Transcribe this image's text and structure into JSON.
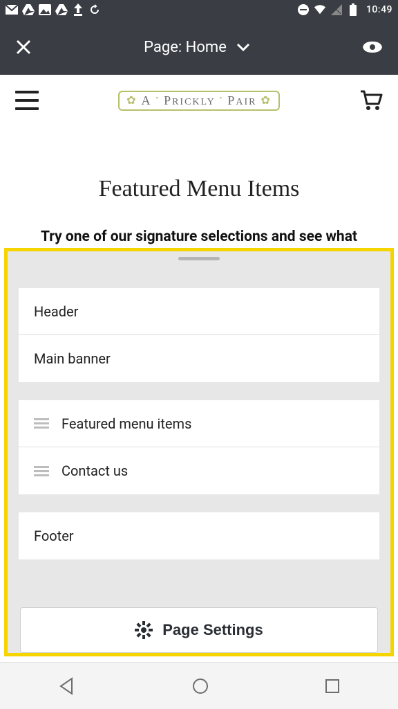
{
  "statusbar": {
    "time": "10:49",
    "left_icons": [
      "gmail-icon",
      "drive-icon",
      "photos-icon",
      "drive-icon-2",
      "upload-icon",
      "sync-icon"
    ],
    "right_icons": [
      "dnd-icon",
      "wifi-icon",
      "signal-icon",
      "battery-icon"
    ]
  },
  "appbar": {
    "title": "Page: Home"
  },
  "site": {
    "logo_text": "A · Prickly · Pair"
  },
  "page": {
    "heading": "Featured Menu Items",
    "tagline": "Try one of our signature selections and see what"
  },
  "sheet": {
    "group1": [
      {
        "label": "Header",
        "has_grip": false
      },
      {
        "label": "Main banner",
        "has_grip": false
      }
    ],
    "group2": [
      {
        "label": "Featured menu items",
        "has_grip": true
      },
      {
        "label": "Contact us",
        "has_grip": true
      }
    ],
    "group3": [
      {
        "label": "Footer",
        "has_grip": false
      }
    ],
    "settings_label": "Page Settings"
  }
}
